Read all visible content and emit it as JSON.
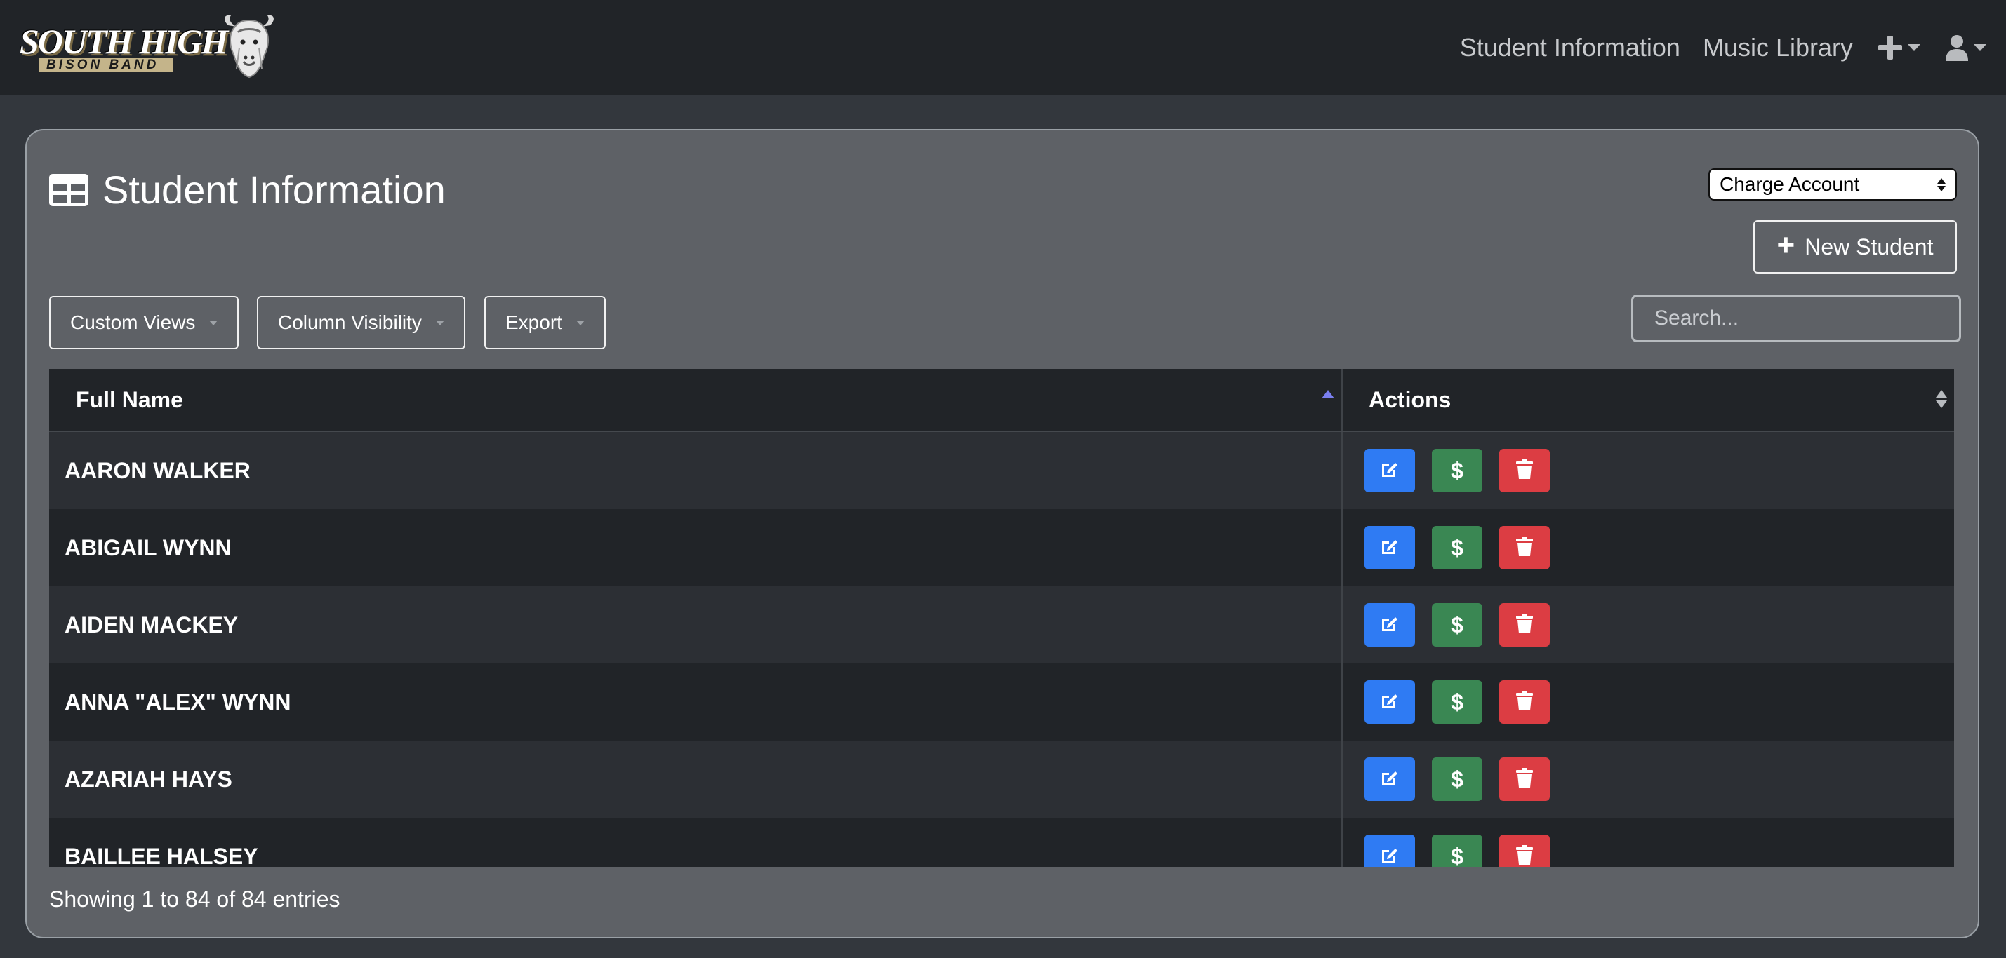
{
  "brand": {
    "top_text": "SOUTH HIGH",
    "bottom_text": "BISON BAND",
    "logo_icon": "bison-head-icon"
  },
  "nav": {
    "links": [
      "Student Information",
      "Music Library"
    ],
    "add_icon": "plus-icon",
    "user_icon": "user-icon"
  },
  "page": {
    "title": "Student Information",
    "title_icon": "table-icon",
    "select_value": "Charge Account",
    "new_button_label": "New Student",
    "toolbar": {
      "custom_views": "Custom Views",
      "column_visibility": "Column Visibility",
      "export": "Export"
    },
    "search_placeholder": "Search..."
  },
  "table": {
    "headers": {
      "name": "Full Name",
      "actions": "Actions"
    },
    "rows": [
      {
        "name": "AARON WALKER"
      },
      {
        "name": "ABIGAIL WYNN"
      },
      {
        "name": "AIDEN MACKEY"
      },
      {
        "name": "ANNA \"ALEX\" WYNN"
      },
      {
        "name": "AZARIAH HAYS"
      },
      {
        "name": "BAILLEE HALSEY"
      }
    ],
    "action_pay_symbol": "$"
  },
  "footer": {
    "info": "Showing 1 to 84 of 84 entries"
  },
  "colors": {
    "edit": "#2f7bf3",
    "pay": "#3a8753",
    "delete": "#dc3d43",
    "navbar": "#212428",
    "card": "#5e6166"
  }
}
